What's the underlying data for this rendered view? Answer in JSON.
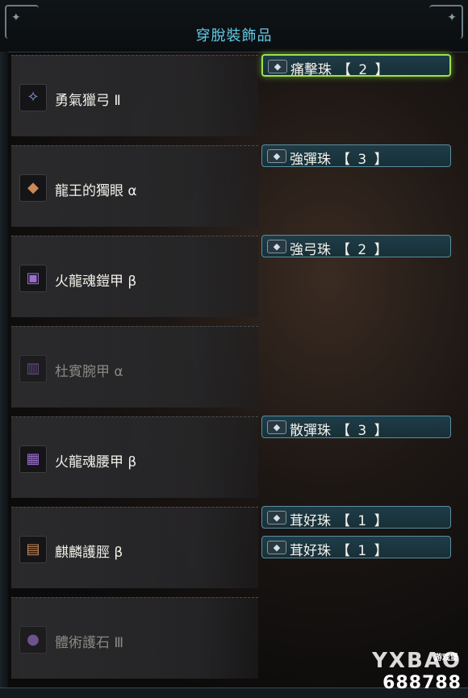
{
  "header": {
    "title": "穿脫裝飾品"
  },
  "equipment": [
    {
      "name": "勇氣獵弓 Ⅱ",
      "icon": "bow-icon",
      "icon_glyph": "✧",
      "icon_color": "#8a9bd9",
      "dim": false
    },
    {
      "name": "龍王的獨眼 α",
      "icon": "head-armor-icon",
      "icon_glyph": "◆",
      "icon_color": "#c98a5a",
      "dim": false
    },
    {
      "name": "火龍魂鎧甲 β",
      "icon": "chest-armor-icon",
      "icon_glyph": "▣",
      "icon_color": "#9b6fd0",
      "dim": false
    },
    {
      "name": "杜賓腕甲 α",
      "icon": "arm-armor-icon",
      "icon_glyph": "▥",
      "icon_color": "#8d5fc0",
      "dim": true
    },
    {
      "name": "火龍魂腰甲 β",
      "icon": "waist-armor-icon",
      "icon_glyph": "▦",
      "icon_color": "#9b6fd0",
      "dim": false
    },
    {
      "name": "麒麟護脛 β",
      "icon": "leg-armor-icon",
      "icon_glyph": "▤",
      "icon_color": "#c98a5a",
      "dim": false
    },
    {
      "name": "體術護石 Ⅲ",
      "icon": "charm-icon",
      "icon_glyph": "●",
      "icon_color": "#9b6fd0",
      "dim": true
    }
  ],
  "decorations": [
    {
      "name": "痛擊珠",
      "level": "【 2 】",
      "icon": "decoration-gem-icon",
      "selected": true
    },
    {
      "name": "強彈珠",
      "level": "【 3 】",
      "icon": "decoration-gem-icon",
      "selected": false
    },
    {
      "name": "強弓珠",
      "level": "【 2 】",
      "icon": "decoration-gem-icon",
      "selected": false
    },
    {
      "name": "散彈珠",
      "level": "【 3 】",
      "icon": "decoration-gem-icon",
      "selected": false
    },
    {
      "name": "茸好珠",
      "level": "【 1 】",
      "icon": "decoration-gem-icon",
      "selected": false
    },
    {
      "name": "茸好珠",
      "level": "【 1 】",
      "icon": "decoration-gem-icon",
      "selected": false
    }
  ],
  "watermark": {
    "line1": "YXBAO",
    "line2": "688788",
    "tag": "游戏堡"
  }
}
